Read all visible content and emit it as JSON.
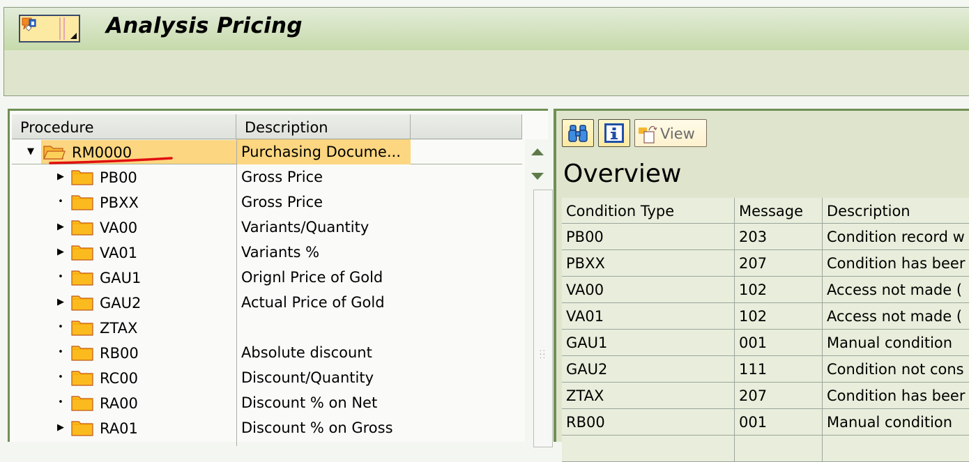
{
  "window": {
    "title": "Analysis Pricing"
  },
  "tree": {
    "columns": [
      "Procedure",
      "Description",
      ""
    ],
    "root": {
      "procedure": "RM0000",
      "description": "Purchasing Docume...",
      "expanded": true,
      "selected": true,
      "annotation": "red-underline"
    },
    "children": [
      {
        "procedure": "PB00",
        "description": "Gross Price",
        "expander": "collapsed"
      },
      {
        "procedure": "PBXX",
        "description": "Gross Price",
        "expander": "leaf"
      },
      {
        "procedure": "VA00",
        "description": "Variants/Quantity",
        "expander": "collapsed"
      },
      {
        "procedure": "VA01",
        "description": "Variants %",
        "expander": "collapsed"
      },
      {
        "procedure": "GAU1",
        "description": "Orignl Price of Gold",
        "expander": "leaf"
      },
      {
        "procedure": "GAU2",
        "description": "Actual Price of Gold",
        "expander": "collapsed"
      },
      {
        "procedure": "ZTAX",
        "description": "",
        "expander": "leaf"
      },
      {
        "procedure": "RB00",
        "description": "Absolute discount",
        "expander": "leaf"
      },
      {
        "procedure": "RC00",
        "description": "Discount/Quantity",
        "expander": "leaf"
      },
      {
        "procedure": "RA00",
        "description": "Discount % on Net",
        "expander": "leaf"
      },
      {
        "procedure": "RA01",
        "description": "Discount % on Gross",
        "expander": "collapsed"
      }
    ]
  },
  "overview": {
    "toolbar": {
      "find_icon": "binoculars-icon",
      "info_icon": "info-icon",
      "view_label": "View"
    },
    "title": "Overview",
    "columns": [
      "Condition Type",
      "Message",
      "Description"
    ],
    "rows": [
      {
        "condition_type": "PB00",
        "message": "203",
        "description": "Condition record w"
      },
      {
        "condition_type": "PBXX",
        "message": "207",
        "description": "Condition has beer"
      },
      {
        "condition_type": "VA00",
        "message": "102",
        "description": "Access not made ("
      },
      {
        "condition_type": "VA01",
        "message": "102",
        "description": "Access not made ("
      },
      {
        "condition_type": "GAU1",
        "message": "001",
        "description": "Manual condition"
      },
      {
        "condition_type": "GAU2",
        "message": "111",
        "description": "Condition not cons"
      },
      {
        "condition_type": "ZTAX",
        "message": "207",
        "description": "Condition has beer"
      },
      {
        "condition_type": "RB00",
        "message": "001",
        "description": "Manual condition"
      }
    ]
  },
  "colors": {
    "selection": "#fcd680",
    "title_bar_top": "#e3ecd8",
    "title_bar_bottom": "#c6daab",
    "panel_border": "#6f8f55",
    "annotation_red": "#e01010"
  }
}
